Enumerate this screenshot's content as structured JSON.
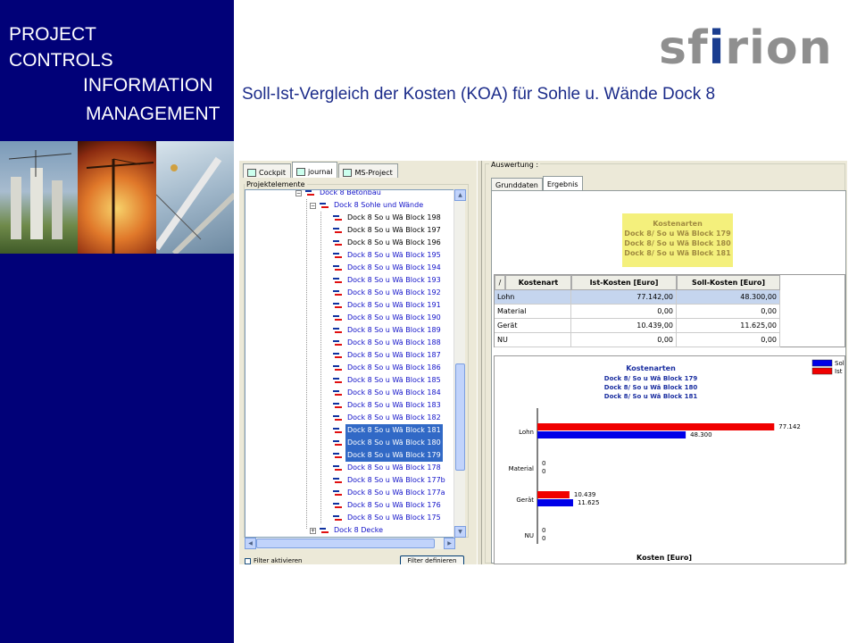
{
  "brand": {
    "line1": "PROJECT",
    "line2": "CONTROLS",
    "line3": "INFORMATION",
    "line4": "MANAGEMENT"
  },
  "logo": {
    "pre": "sf",
    "mid": "i",
    "post": "rion"
  },
  "title": "Soll-Ist-Vergleich der Kosten (KOA) für Sohle u. Wände Dock 8",
  "left_panel": {
    "tabs": [
      {
        "label": "Cockpit",
        "icon": "chart-icon"
      },
      {
        "label": "journal",
        "icon": "journal-icon"
      },
      {
        "label": "MS-Project",
        "icon": "ms-project-icon"
      }
    ],
    "fieldset_label": "Projektelemente",
    "tree": [
      {
        "label": "Dock 8  Betonbau",
        "level": 0,
        "expander": "⊟",
        "style": "blue"
      },
      {
        "label": "Dock 8  Sohle und Wände",
        "level": 1,
        "expander": "⊟",
        "style": "blue"
      },
      {
        "label": "Dock 8  So u Wä Block 198",
        "level": 2,
        "style": "black"
      },
      {
        "label": "Dock 8  So u Wä Block 197",
        "level": 2,
        "style": "black"
      },
      {
        "label": "Dock 8  So u Wä Block 196",
        "level": 2,
        "style": "black"
      },
      {
        "label": "Dock 8  So u Wä Block 195",
        "level": 2,
        "style": "blue"
      },
      {
        "label": "Dock 8  So u Wä Block 194",
        "level": 2,
        "style": "blue"
      },
      {
        "label": "Dock 8  So u Wä Block 193",
        "level": 2,
        "style": "blue"
      },
      {
        "label": "Dock 8  So u Wä Block 192",
        "level": 2,
        "style": "blue"
      },
      {
        "label": "Dock 8  So u Wä Block 191",
        "level": 2,
        "style": "blue"
      },
      {
        "label": "Dock 8  So u Wä Block 190",
        "level": 2,
        "style": "blue"
      },
      {
        "label": "Dock 8  So u Wä Block 189",
        "level": 2,
        "style": "blue"
      },
      {
        "label": "Dock 8  So u Wä Block 188",
        "level": 2,
        "style": "blue"
      },
      {
        "label": "Dock 8  So u Wä Block 187",
        "level": 2,
        "style": "blue"
      },
      {
        "label": "Dock 8  So u Wä Block 186",
        "level": 2,
        "style": "blue"
      },
      {
        "label": "Dock 8  So u Wä Block 185",
        "level": 2,
        "style": "blue"
      },
      {
        "label": "Dock 8  So u Wä Block 184",
        "level": 2,
        "style": "blue"
      },
      {
        "label": "Dock 8  So u Wä Block 183",
        "level": 2,
        "style": "blue"
      },
      {
        "label": "Dock 8  So u Wä Block 182",
        "level": 2,
        "style": "blue"
      },
      {
        "label": "Dock 8  So u Wä Block 181",
        "level": 2,
        "style": "sel"
      },
      {
        "label": "Dock 8  So u Wä Block 180",
        "level": 2,
        "style": "sel"
      },
      {
        "label": "Dock 8  So u Wä Block 179",
        "level": 2,
        "style": "sel"
      },
      {
        "label": "Dock 8  So u Wä Block 178",
        "level": 2,
        "style": "blue"
      },
      {
        "label": "Dock 8  So u Wä Block 177b",
        "level": 2,
        "style": "blue"
      },
      {
        "label": "Dock 8  So u Wä Block 177a",
        "level": 2,
        "style": "blue"
      },
      {
        "label": "Dock 8  So u Wä Block 176",
        "level": 2,
        "style": "blue"
      },
      {
        "label": "Dock 8  So u Wä Block 175",
        "level": 2,
        "style": "blue"
      },
      {
        "label": "Dock 8  Decke",
        "level": 1,
        "expander": "⊞",
        "style": "blue"
      }
    ],
    "filter_checkbox": "Filter aktivieren",
    "filter_button": "Filter definieren"
  },
  "right_panel": {
    "fieldset_label": "Auswertung :",
    "tabs": [
      "Grunddaten",
      "Ergebnis"
    ],
    "active_tab": 1,
    "selection_box": {
      "title": "Kostenarten",
      "lines": [
        "Dock 8/ So u Wä Block 179",
        "Dock 8/ So u Wä Block 180",
        "Dock 8/ So u Wä Block 181"
      ]
    },
    "table": {
      "sort_marker": "/",
      "columns": [
        "Kostenart",
        "Ist-Kosten [Euro]",
        "Soll-Kosten [Euro]"
      ],
      "rows": [
        {
          "kostenart": "Lohn",
          "ist": "77.142,00",
          "soll": "48.300,00"
        },
        {
          "kostenart": "Material",
          "ist": "0,00",
          "soll": "0,00"
        },
        {
          "kostenart": "Gerät",
          "ist": "10.439,00",
          "soll": "11.625,00"
        },
        {
          "kostenart": "NU",
          "ist": "0,00",
          "soll": "0,00"
        }
      ]
    }
  },
  "colors": {
    "soll": "#0000e8",
    "ist": "#f00000",
    "sidebar": "#010178",
    "title": "#1c2c8a"
  },
  "chart_data": {
    "type": "bar",
    "orientation": "horizontal",
    "title": "Kostenarten",
    "subtitle_lines": [
      "Dock 8/ So u Wä Block 179",
      "Dock 8/ So u Wä Block 180",
      "Dock 8/ So u Wä Block 181"
    ],
    "xlabel": "Kosten [Euro]",
    "ylabel": "",
    "categories": [
      "Lohn",
      "Material",
      "Gerät",
      "NU"
    ],
    "series": [
      {
        "name": "Ist",
        "color": "#f00000",
        "values": [
          77142,
          0,
          10439,
          0
        ],
        "labels": [
          "77.142",
          "0",
          "10.439",
          "0"
        ]
      },
      {
        "name": "Soll",
        "color": "#0000e8",
        "values": [
          48300,
          0,
          11625,
          0
        ],
        "labels": [
          "48.300",
          "0",
          "11.625",
          "0"
        ]
      }
    ],
    "legend": [
      {
        "name": "Soll",
        "color": "#0000e8"
      },
      {
        "name": "Ist",
        "color": "#f00000"
      }
    ],
    "legend_position": "top-right",
    "xlim": [
      0,
      82000
    ],
    "grid": false
  }
}
